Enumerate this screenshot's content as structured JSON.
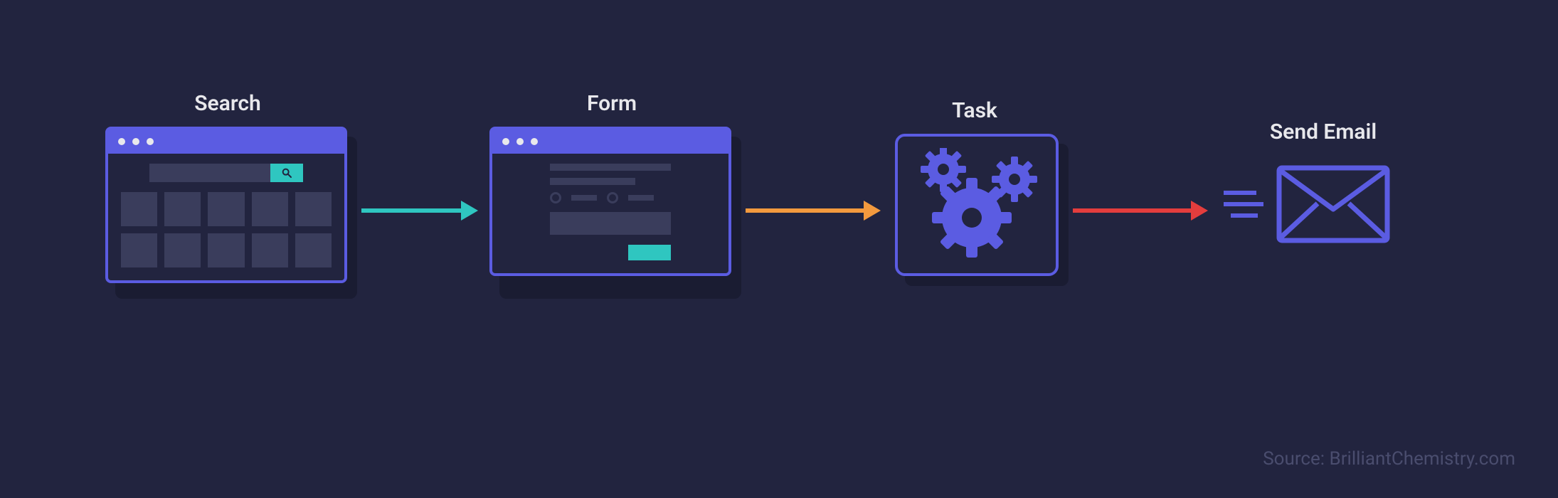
{
  "steps": {
    "search": {
      "label": "Search"
    },
    "form": {
      "label": "Form"
    },
    "task": {
      "label": "Task"
    },
    "email": {
      "label": "Send Email"
    }
  },
  "colors": {
    "arrow1": "#2fc6c0",
    "arrow2": "#f39a3e",
    "arrow3": "#e43d3d",
    "accent": "#5b5ce2",
    "teal": "#2fc6c0"
  },
  "source_credit": "Source: BrilliantChemistry.com"
}
